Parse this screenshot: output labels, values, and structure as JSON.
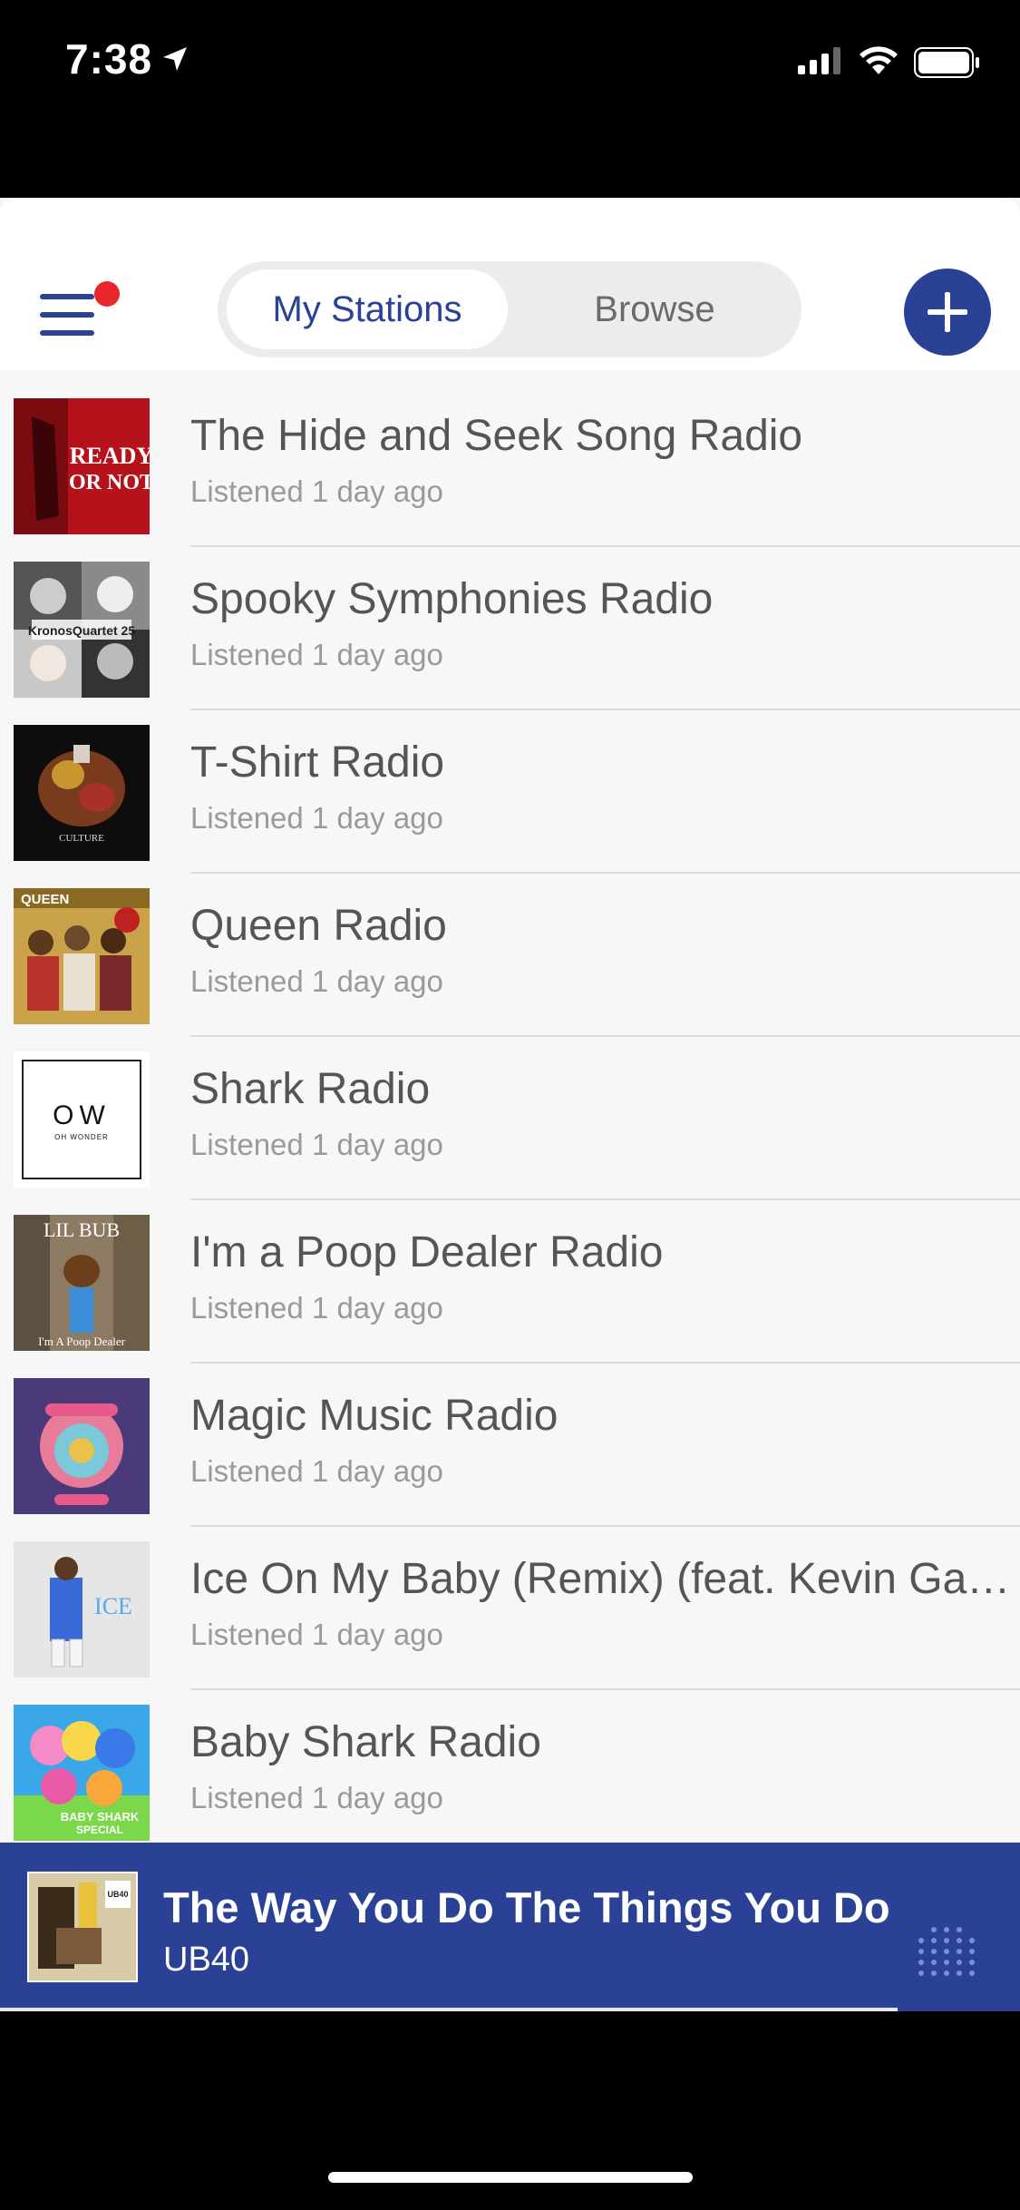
{
  "status_bar": {
    "time": "7:38"
  },
  "header": {
    "tabs": [
      {
        "label": "My Stations",
        "active": true
      },
      {
        "label": "Browse",
        "active": false
      }
    ]
  },
  "stations": [
    {
      "title": "The Hide and Seek Song Radio",
      "subtitle": "Listened 1 day ago",
      "art_text": "READY OR NOT"
    },
    {
      "title": "Spooky Symphonies Radio",
      "subtitle": "Listened 1 day ago",
      "art_text": "Kronos Quartet 25"
    },
    {
      "title": "T-Shirt Radio",
      "subtitle": "Listened 1 day ago",
      "art_text": "CULTURE"
    },
    {
      "title": "Queen Radio",
      "subtitle": "Listened 1 day ago",
      "art_text": "QUEEN"
    },
    {
      "title": "Shark Radio",
      "subtitle": "Listened 1 day ago",
      "art_text": "OW",
      "art_text2": "OH WONDER"
    },
    {
      "title": "I'm a Poop Dealer Radio",
      "subtitle": "Listened 1 day ago",
      "art_text": "I'm A Poop Dealer"
    },
    {
      "title": "Magic Music Radio",
      "subtitle": "Listened 1 day ago",
      "art_text": ""
    },
    {
      "title": "Ice On My Baby (Remix) (feat. Kevin Gates) Radio",
      "subtitle": "Listened 1 day ago",
      "art_text": "ICE"
    },
    {
      "title": "Baby Shark Radio",
      "subtitle": "Listened 1 day ago",
      "art_text": "BABY SHARK SPECIAL"
    }
  ],
  "now_playing": {
    "title": "The Way You Do The Things You Do",
    "artist": "UB40",
    "progress": 0.88
  },
  "colors": {
    "accent": "#2a4196",
    "notification": "#e8262b"
  }
}
